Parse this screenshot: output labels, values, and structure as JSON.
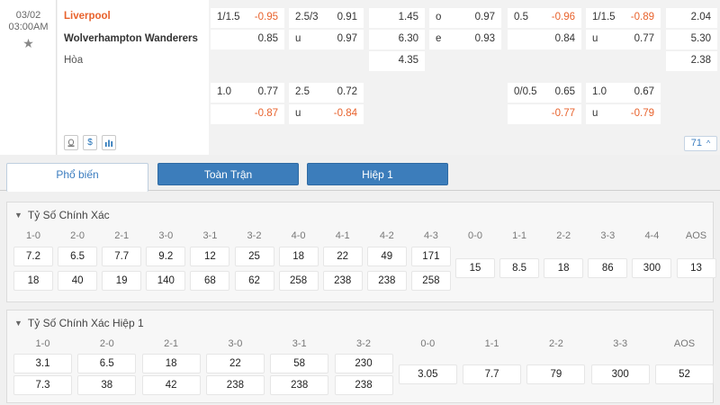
{
  "match": {
    "date": "03/02",
    "time": "03:00AM",
    "home": "Liverpool",
    "away": "Wolverhampton Wanderers",
    "draw": "Hòa",
    "more_count": "71"
  },
  "odds": {
    "ft_hdp": {
      "line": "1/1.5",
      "home": "-0.95",
      "away": "0.85"
    },
    "ft_ou": {
      "line": "2.5/3",
      "over": "0.91",
      "under_label": "u",
      "under": "0.97"
    },
    "ft_1x2": {
      "home": "1.45",
      "away": "6.30",
      "draw": "4.35"
    },
    "ft_oe": {
      "odd_label": "o",
      "odd": "0.97",
      "even_label": "e",
      "even": "0.93"
    },
    "h1_hdp": {
      "line": "0.5",
      "home": "-0.96",
      "away": "0.84"
    },
    "h1_ou": {
      "line": "1/1.5",
      "over": "-0.89",
      "under_label": "u",
      "under": "0.77"
    },
    "h1_1x2": {
      "home": "2.04",
      "away": "5.30",
      "draw": "2.38"
    },
    "ft_hdp_alt": {
      "line": "1.0",
      "home": "0.77",
      "away": "-0.87"
    },
    "ft_ou_alt": {
      "line": "2.5",
      "over": "0.72",
      "under_label": "u",
      "under": "-0.84"
    },
    "h1_hdp_alt": {
      "line": "0/0.5",
      "home": "0.65",
      "away": "-0.77"
    },
    "h1_ou_alt": {
      "line": "1.0",
      "over": "0.67",
      "under_label": "u",
      "under": "-0.79"
    }
  },
  "tabs": [
    {
      "label": "Phổ biến",
      "active": true
    },
    {
      "label": "Toàn Trận",
      "active": false
    },
    {
      "label": "Hiệp 1",
      "active": false
    }
  ],
  "correct_score": {
    "title": "Tỷ Số Chính Xác",
    "headers": [
      "1-0",
      "2-0",
      "2-1",
      "3-0",
      "3-1",
      "3-2",
      "4-0",
      "4-1",
      "4-2",
      "4-3",
      "0-0",
      "1-1",
      "2-2",
      "3-3",
      "4-4",
      "AOS"
    ],
    "row1": [
      "7.2",
      "6.5",
      "7.7",
      "9.2",
      "12",
      "25",
      "18",
      "22",
      "49",
      "171"
    ],
    "row2": [
      "18",
      "40",
      "19",
      "140",
      "68",
      "62",
      "258",
      "238",
      "238",
      "258"
    ],
    "draws": [
      "15",
      "8.5",
      "18",
      "86",
      "300",
      "13"
    ]
  },
  "correct_score_h1": {
    "title": "Tỷ Số Chính Xác Hiệp 1",
    "headers": [
      "1-0",
      "2-0",
      "2-1",
      "3-0",
      "3-1",
      "3-2",
      "0-0",
      "1-1",
      "2-2",
      "3-3",
      "AOS"
    ],
    "row1": [
      "3.1",
      "6.5",
      "18",
      "22",
      "58",
      "230"
    ],
    "row2": [
      "7.3",
      "38",
      "42",
      "238",
      "238",
      "238"
    ],
    "draws": [
      "3.05",
      "7.7",
      "79",
      "300",
      "52"
    ]
  },
  "icons": {
    "star": "star-icon",
    "tv": "tv-icon",
    "dollar": "dollar-icon",
    "stats": "stats-icon",
    "chevron": "chevron-up-icon"
  }
}
